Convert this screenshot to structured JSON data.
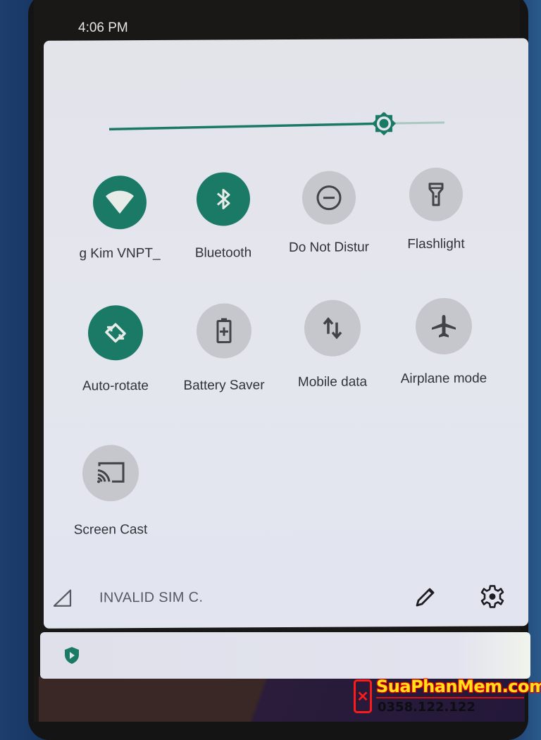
{
  "status_bar": {
    "time": "4:06 PM"
  },
  "quick_settings": {
    "brightness": {
      "level_percent": 80,
      "icon": "brightness-icon",
      "active_color": "#1b7a66",
      "track_color": "#a9c9c0"
    },
    "tiles": [
      {
        "id": "wifi",
        "label": "g Kim VNPT_",
        "icon": "wifi-icon",
        "state": "on"
      },
      {
        "id": "bluetooth",
        "label": "Bluetooth",
        "icon": "bluetooth-icon",
        "state": "on"
      },
      {
        "id": "dnd",
        "label": "Do Not Distur",
        "icon": "do-not-disturb-icon",
        "state": "off"
      },
      {
        "id": "flashlight",
        "label": "Flashlight",
        "icon": "flashlight-icon",
        "state": "off"
      },
      {
        "id": "autorotate",
        "label": "Auto-rotate",
        "icon": "auto-rotate-icon",
        "state": "on"
      },
      {
        "id": "battery",
        "label": "Battery Saver",
        "icon": "battery-saver-icon",
        "state": "off"
      },
      {
        "id": "mobiledata",
        "label": "Mobile data",
        "icon": "mobile-data-icon",
        "state": "off"
      },
      {
        "id": "airplane",
        "label": "Airplane mode",
        "icon": "airplane-icon",
        "state": "off"
      },
      {
        "id": "cast",
        "label": "Screen Cast",
        "icon": "screen-cast-icon",
        "state": "off"
      }
    ],
    "footer": {
      "carrier_text": "INVALID SIM C.",
      "signal_icon": "no-signal-icon",
      "edit_icon": "pencil-icon",
      "settings_icon": "gear-icon"
    }
  },
  "notification": {
    "icon": "shield-play-icon"
  },
  "watermark": {
    "title": "SuaPhanMem.com",
    "phone": "0358.122.122"
  },
  "colors": {
    "accent": "#1b7a66",
    "tile_off": "#c6c7cd",
    "panel_bg": "#e4e6ee",
    "text": "#2f3338"
  }
}
